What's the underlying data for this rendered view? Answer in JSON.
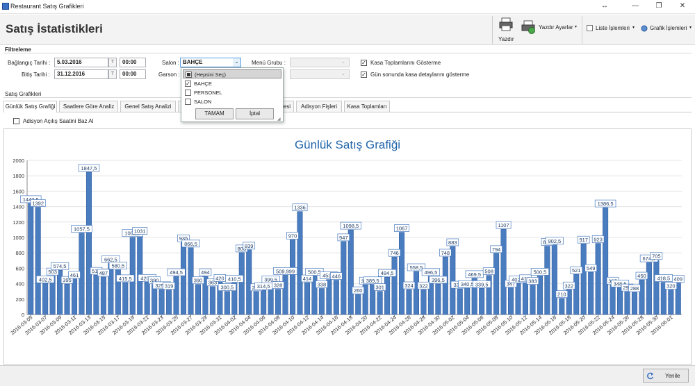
{
  "window": {
    "title": "Restaurant Satış Grafikleri"
  },
  "ribbon": {
    "page_title": "Satış İstatistikleri",
    "print_label": "Yazdır",
    "print_settings_label": "Yazdır Ayarlar",
    "list_ops_label": "Liste İşlemleri",
    "chart_ops_label": "Grafik İşlemleri"
  },
  "filter": {
    "section_title": "Filtreleme",
    "start_date_label": "Bağlangıç Tarihi :",
    "start_date": "5.03.2016",
    "start_time": "00:00",
    "end_date_label": "Bitiş Tarihi :",
    "end_date": "31.12.2016",
    "end_time": "00:00",
    "date_btn": "T",
    "salon_label": "Salon :",
    "salon_value": "BAHÇE",
    "garson_label": "Garson :",
    "menu_group_label": "Menü Grubu :",
    "kasa_totals_label": "Kasa Toplamlarını Gösterme",
    "day_end_label": "Gün sonunda kasa detaylarını gösterme"
  },
  "dropdown": {
    "items": [
      {
        "label": "(Hepsini Seç)",
        "state": "partial"
      },
      {
        "label": "BAHÇE",
        "state": "checked"
      },
      {
        "label": "PERSONEL",
        "state": "unchecked"
      },
      {
        "label": "SALON",
        "state": "unchecked"
      }
    ],
    "ok_label": "TAMAM",
    "cancel_label": "İptal"
  },
  "charts_section_title": "Satış Grafikleri",
  "tabs": [
    {
      "label": "Günlük Satış Grafiği",
      "active": true
    },
    {
      "label": "Saatlere Göre Analiz",
      "active": false
    },
    {
      "label": "Genel Satış Analizi",
      "active": false
    },
    {
      "label": "esi",
      "active": false
    },
    {
      "label": "Adisyon Fişleri",
      "active": false
    },
    {
      "label": "Kasa Toplamları",
      "active": false
    }
  ],
  "adisyon_option_label": "Adisyon Açılış Saatini Baz Al",
  "refresh_label": "Yenile",
  "colors": {
    "bar": "#4a7cc0",
    "bar_border": "#2b5797",
    "title": "#2266aa"
  },
  "chart_data": {
    "type": "bar",
    "title": "Günlük Satış Grafiği",
    "ylim": [
      0,
      2000
    ],
    "yticks": [
      0,
      200,
      400,
      600,
      800,
      1000,
      1200,
      1400,
      1600,
      1800,
      2000
    ],
    "x_labels": [
      "2016-03-05",
      "2016-03-07",
      "2016-03-09",
      "2016-03-11",
      "2016-03-13",
      "2016-03-15",
      "2016-03-17",
      "2016-03-19",
      "2016-03-21",
      "2016-03-23",
      "2016-03-25",
      "2016-03-27",
      "2016-03-29",
      "2016-03-31",
      "2016-04-02",
      "2016-04-04",
      "2016-04-06",
      "2016-04-08",
      "2016-04-10",
      "2016-04-12",
      "2016-04-14",
      "2016-04-16",
      "2016-04-18",
      "2016-04-20",
      "2016-04-22",
      "2016-04-24",
      "2016-04-26",
      "2016-04-28",
      "2016-04-30",
      "2016-05-02",
      "2016-05-04",
      "2016-05-06",
      "2016-05-08",
      "2016-05-10",
      "2016-05-12",
      "2016-05-14",
      "2016-05-16",
      "2016-05-18",
      "2016-05-20",
      "2016-05-22",
      "2016-05-24",
      "2016-05-26",
      "2016-05-28",
      "2016-05-30",
      "2016-06-01"
    ],
    "values": [
      1442.5,
      1392,
      402.5,
      503,
      574.5,
      395,
      461,
      1057.5,
      1847.5,
      512,
      487,
      662.5,
      580.5,
      415.5,
      1002.5,
      1031,
      420.5,
      390,
      325.5,
      319,
      494.5,
      935,
      866.5,
      390,
      494,
      363,
      420,
      300.5,
      410.5,
      803,
      839,
      299,
      314.5,
      399.5,
      328,
      509.999,
      970,
      1336,
      414,
      500.5,
      338,
      453.5,
      446,
      947,
      1098.5,
      260,
      385,
      389.5,
      301,
      484.5,
      746,
      1067,
      324,
      558.5,
      322,
      496.5,
      396.5,
      748,
      883,
      332.5,
      340.5,
      469.5,
      339.5,
      508,
      794,
      1107,
      347,
      402.5,
      416,
      383,
      500.5,
      887,
      902.5,
      210,
      322,
      521,
      917,
      549,
      923,
      1386.5,
      385,
      348.5,
      296,
      288,
      450,
      674.5,
      705,
      418.5,
      320,
      409
    ],
    "labels": [
      "1442,5",
      "1392",
      "402,5",
      "503",
      "574,5",
      "395",
      "461",
      "1057,5",
      "1847,5",
      "512",
      "487",
      "662,5",
      "580,5",
      "415,5",
      "1002,5",
      "1031",
      "420,5",
      "390",
      "325,5",
      "319",
      "494,5",
      "935",
      "866,5",
      "390",
      "494",
      "363",
      "420",
      "300,5",
      "410,5",
      "803",
      "839",
      "299",
      "314,5",
      "399,5",
      "328",
      "509,999",
      "970",
      "1336",
      "414",
      "500,5",
      "338",
      "453,5",
      "446",
      "947",
      "1098,5",
      "260",
      "385",
      "389,5",
      "301",
      "484,5",
      "746",
      "1067",
      "324",
      "558,5",
      "322",
      "496,5",
      "396,5",
      "748",
      "883",
      "332,5",
      "340,5",
      "469,5",
      "339,5",
      "508",
      "794",
      "1107",
      "347",
      "402,5",
      "416",
      "383",
      "500,5",
      "887",
      "902,5",
      "210",
      "322",
      "521",
      "917",
      "549",
      "923",
      "1386,5",
      "385",
      "348,5",
      "296",
      "288",
      "450",
      "674,5",
      "705",
      "418,5",
      "320",
      "409"
    ]
  }
}
